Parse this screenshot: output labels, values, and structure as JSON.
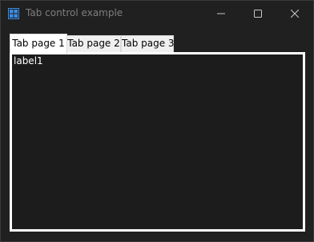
{
  "window": {
    "title": "Tab control example",
    "app_icon": "app-window-icon",
    "caption_buttons": {
      "minimize_icon": "minimize-icon",
      "maximize_icon": "maximize-icon",
      "close_icon": "close-icon"
    }
  },
  "tabs": {
    "selected_index": 0,
    "items": [
      {
        "label": "Tab page 1"
      },
      {
        "label": "Tab page 2"
      },
      {
        "label": "Tab page 3"
      }
    ]
  },
  "page": {
    "label1": "label1"
  },
  "colors": {
    "titlebar_bg": "#202020",
    "page_bg": "#1c1c1c",
    "title_text": "#7f7f7f",
    "icon_accent": "#3a8ee6"
  }
}
